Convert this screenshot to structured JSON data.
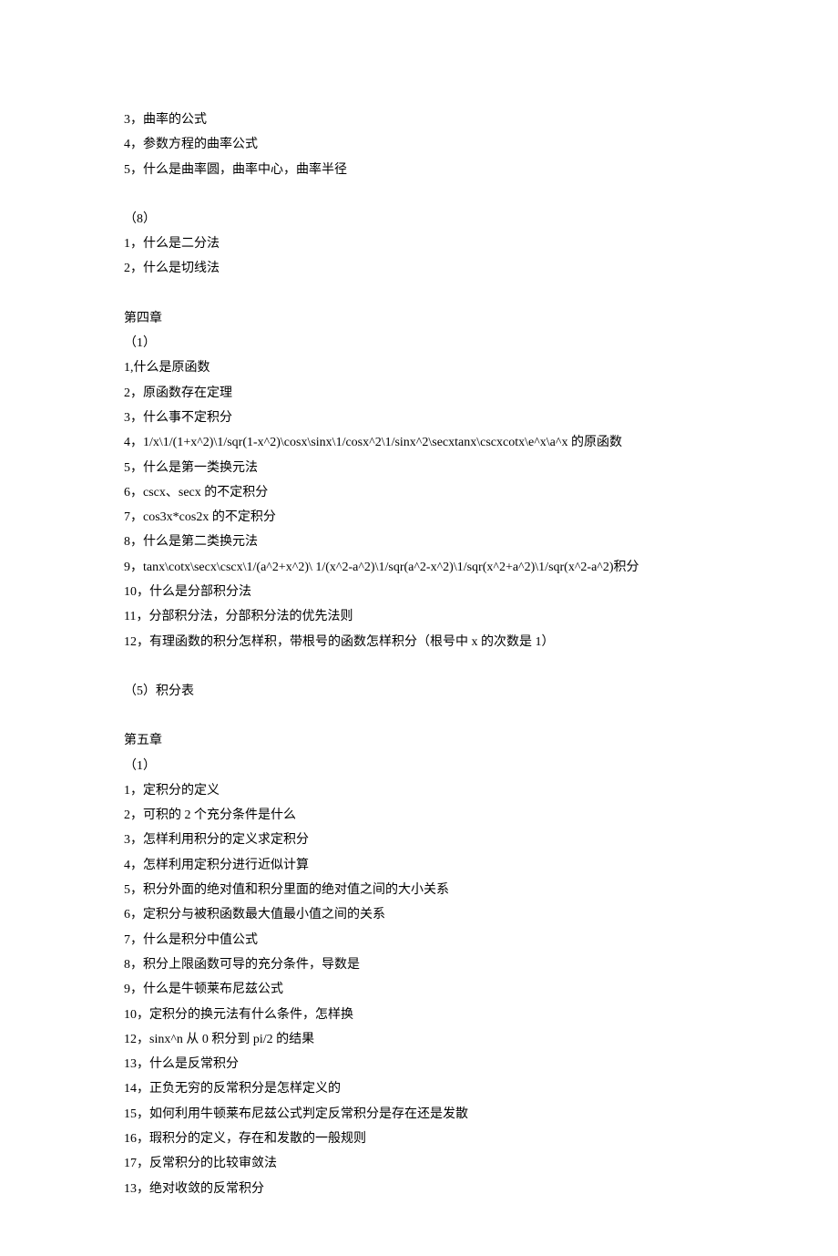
{
  "lines": [
    "3，曲率的公式",
    "4，参数方程的曲率公式",
    "5，什么是曲率圆，曲率中心，曲率半径",
    "",
    "（8）",
    "1，什么是二分法",
    "2，什么是切线法",
    "",
    "第四章",
    "（1）",
    "1,什么是原函数",
    "2，原函数存在定理",
    "3，什么事不定积分",
    "4，1/x\\1/(1+x^2)\\1/sqr(1-x^2)\\cosx\\sinx\\1/cosx^2\\1/sinx^2\\secxtanx\\cscxcotx\\e^x\\a^x 的原函数",
    "5，什么是第一类换元法",
    "6，cscx、secx 的不定积分",
    "7，cos3x*cos2x 的不定积分",
    "8，什么是第二类换元法",
    "9，tanx\\cotx\\secx\\cscx\\1/(a^2+x^2)\\ 1/(x^2-a^2)\\1/sqr(a^2-x^2)\\1/sqr(x^2+a^2)\\1/sqr(x^2-a^2)积分",
    "10，什么是分部积分法",
    "11，分部积分法，分部积分法的优先法则",
    "12，有理函数的积分怎样积，带根号的函数怎样积分（根号中 x 的次数是 1）",
    "",
    "（5）积分表",
    "",
    "第五章",
    "（1）",
    "1，定积分的定义",
    "2，可积的 2 个充分条件是什么",
    "3，怎样利用积分的定义求定积分",
    "4，怎样利用定积分进行近似计算",
    "5，积分外面的绝对值和积分里面的绝对值之间的大小关系",
    "6，定积分与被积函数最大值最小值之间的关系",
    "7，什么是积分中值公式",
    "8，积分上限函数可导的充分条件，导数是",
    "9，什么是牛顿莱布尼兹公式",
    "10，定积分的换元法有什么条件，怎样换",
    "12，sinx^n 从 0 积分到 pi/2 的结果",
    "13，什么是反常积分",
    "14，正负无穷的反常积分是怎样定义的",
    "15，如何利用牛顿莱布尼兹公式判定反常积分是存在还是发散",
    "16，瑕积分的定义，存在和发散的一般规则",
    "17，反常积分的比较审敛法",
    "13，绝对收敛的反常积分"
  ]
}
